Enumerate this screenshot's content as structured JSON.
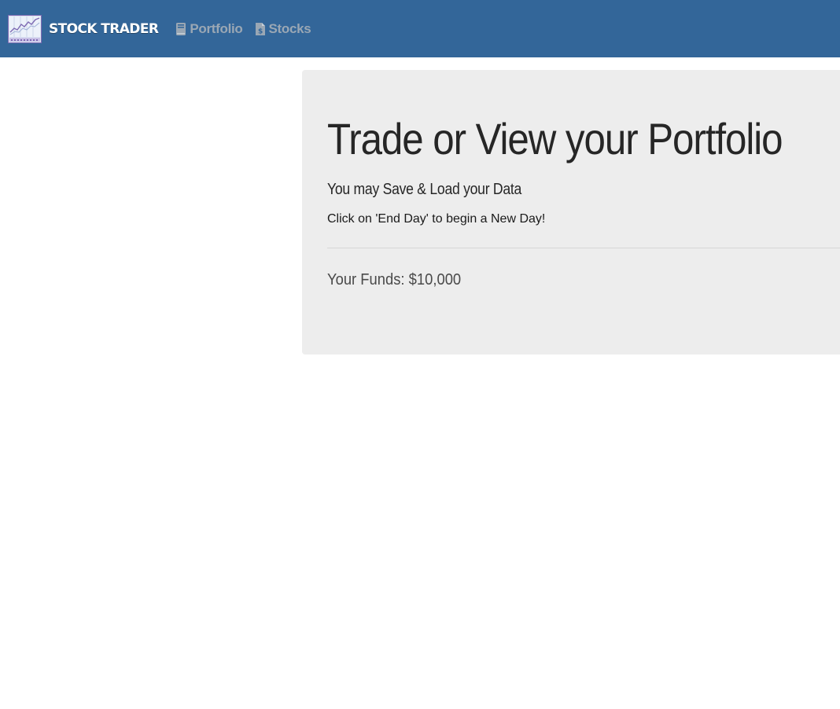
{
  "navbar": {
    "brand": "STOCK TRADER",
    "links": [
      {
        "label": "Portfolio",
        "icon": "book-icon"
      },
      {
        "label": "Stocks",
        "icon": "dollar-file-icon"
      }
    ],
    "background": "#336699"
  },
  "main": {
    "heading": "Trade or View your Portfolio",
    "subheading": "You may Save & Load your Data",
    "note": "Click on 'End Day' to begin a New Day!",
    "funds": "Your Funds: $10,000"
  }
}
